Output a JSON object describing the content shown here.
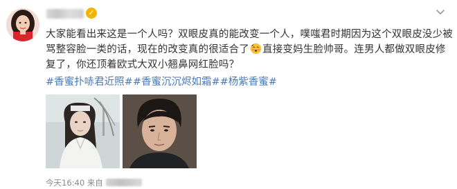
{
  "post": {
    "verified_badge_icon": "verified-star-icon",
    "menu_icon": "chevron-down-icon",
    "text_part1": "大家能看出来这是一个人吗？双眼皮真的能改变一个人，噗嗤君时期因为这个双眼皮没少被骂整容脸一类的话，现在的改变真的很适合了",
    "emoji_icon": "blush-emoji-icon",
    "text_part2": "直接变妈生脸帅哥。连男人都做双眼皮修复了，你还顶着欧式大双小翘鼻网红脸吗？",
    "topics": [
      "#香蜜扑哧君近照#",
      "#香蜜沉沉烬如霜#",
      "#杨紫香蜜#"
    ],
    "images": [
      {
        "name": "costume-drama-photo"
      },
      {
        "name": "modern-portrait-photo"
      }
    ],
    "time_label": "今天16:40",
    "source_prefix": "来自"
  },
  "colors": {
    "text": "#333333",
    "topic_link": "#4a78b8",
    "meta": "#8a8a8a",
    "badge": "#f5b400"
  }
}
